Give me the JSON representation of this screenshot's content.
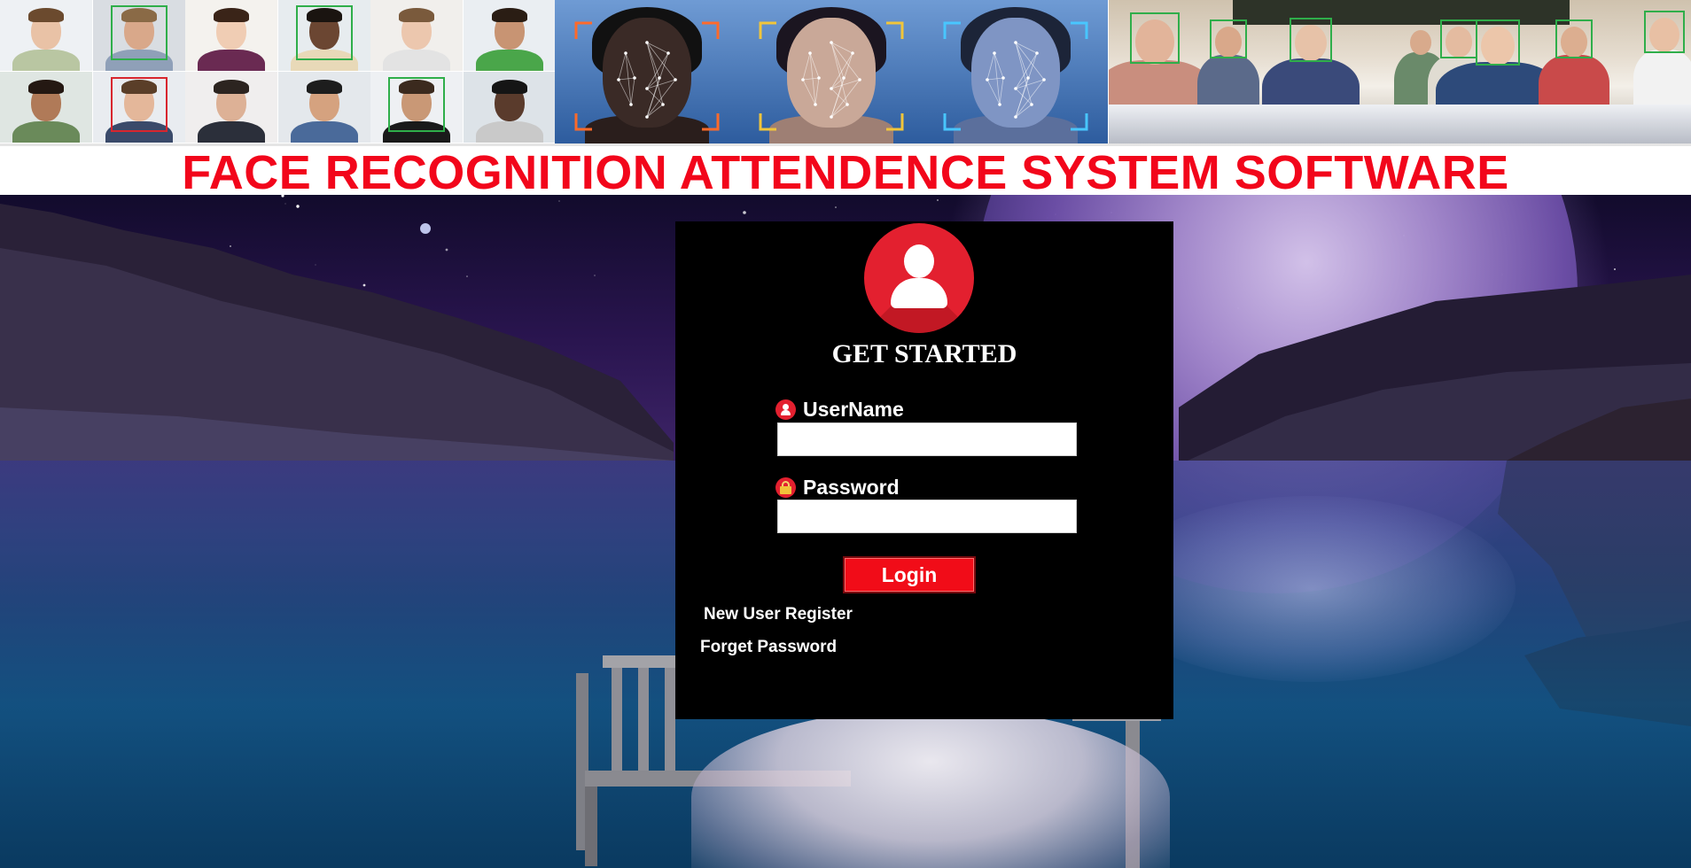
{
  "header": {
    "title": "FACE RECOGNITION ATTENDENCE SYSTEM SOFTWARE"
  },
  "login": {
    "heading": "GET STARTED",
    "username_label": "UserName",
    "username_value": "",
    "password_label": "Password",
    "password_value": "",
    "login_button": "Login",
    "register_link": "New User Register",
    "forgot_link": "Forget Password",
    "user_icon": "user-avatar-icon",
    "password_icon": "lock-icon"
  },
  "colors": {
    "title_red": "#f2061b",
    "accent_red": "#e3202f",
    "button_red": "#f10c18",
    "panel_black": "#000000"
  }
}
